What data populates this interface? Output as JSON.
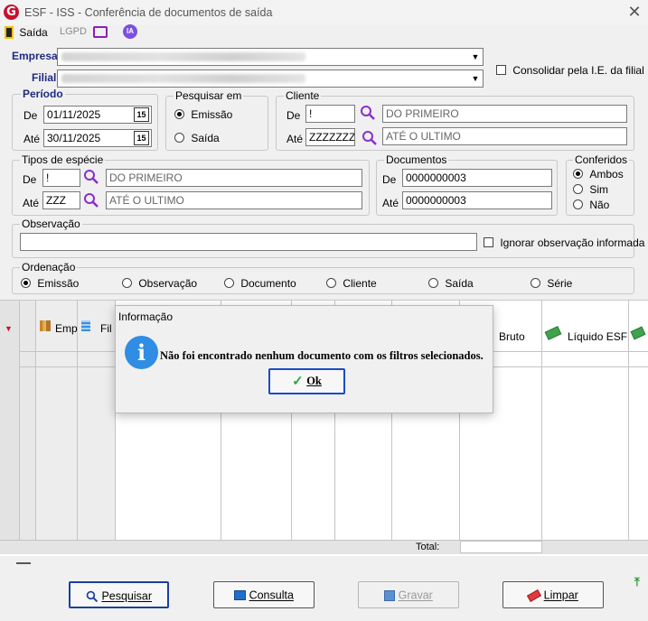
{
  "window": {
    "logo": "G",
    "title": "ESF - ISS - Conferência de documentos de saída",
    "close": "✕"
  },
  "toolbar": {
    "saida_label": "Saída",
    "lgpd_label": "LGPD",
    "ia_label": "IA"
  },
  "empresa": {
    "label": "Empresa"
  },
  "filial": {
    "label": "Filial"
  },
  "consolidar": {
    "label": "Consolidar pela I.E. da filial",
    "checked": false
  },
  "periodo": {
    "title": "Período",
    "de_label": "De",
    "de_value": "01/11/2025",
    "ate_label": "Até",
    "ate_value": "30/11/2025",
    "cal_text": "15"
  },
  "pesquisar_em": {
    "title": "Pesquisar em",
    "options": [
      "Emissão",
      "Saída"
    ],
    "selected": "Emissão"
  },
  "cliente": {
    "title": "Cliente",
    "de_label": "De",
    "de_code": "!",
    "de_name": "DO PRIMEIRO",
    "ate_label": "Até",
    "ate_code": "ZZZZZZZ",
    "ate_name": "ATÉ O ULTIMO"
  },
  "tipos_especie": {
    "title": "Tipos de espécie",
    "de_label": "De",
    "de_code": "!",
    "de_name": "DO PRIMEIRO",
    "ate_label": "Até",
    "ate_code": "ZZZ",
    "ate_name": "ATÉ O ULTIMO"
  },
  "documentos": {
    "title": "Documentos",
    "de_label": "De",
    "de_value": "0000000003",
    "ate_label": "Até",
    "ate_value": "0000000003"
  },
  "conferidos": {
    "title": "Conferidos",
    "options": [
      "Ambos",
      "Sim",
      "Não"
    ],
    "selected": "Ambos"
  },
  "observacao": {
    "title": "Observação",
    "value": "",
    "ignorar_label": "Ignorar observação informada"
  },
  "ordenacao": {
    "title": "Ordenação",
    "options": [
      "Emissão",
      "Observação",
      "Documento",
      "Cliente",
      "Saída",
      "Série"
    ],
    "selected": "Emissão"
  },
  "grid": {
    "headers": [
      "Emp",
      "Fil",
      "Bruto",
      "Líquido ESF"
    ],
    "total_label": "Total:"
  },
  "dialog": {
    "title": "Informação",
    "message": "Não foi encontrado nenhum documento com os filtros selecionados.",
    "ok_label": "Ok",
    "icon": "i"
  },
  "buttons": {
    "pesquisar": "Pesquisar",
    "consulta": "Consulta",
    "gravar": "Gravar",
    "limpar": "Limpar"
  },
  "colors": {
    "accent_blue": "#1f2a80",
    "logo_red": "#c8102e",
    "info_blue": "#2f8de4",
    "lgpd_purple": "#7a1fa2"
  }
}
